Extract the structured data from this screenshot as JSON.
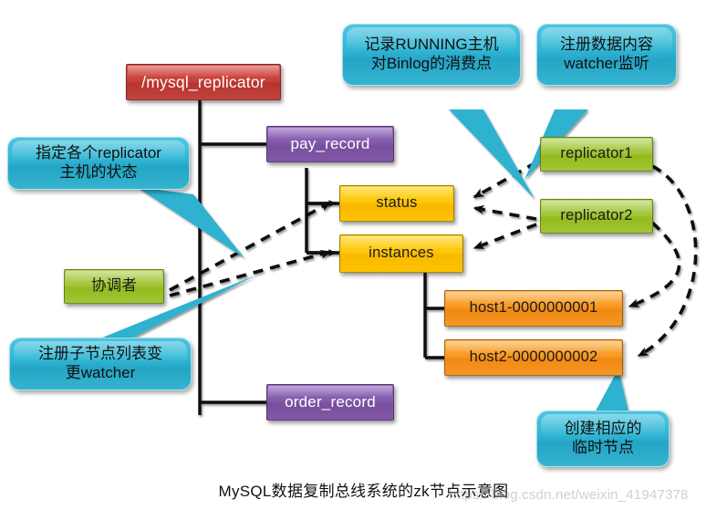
{
  "diagram": {
    "caption": "MySQL数据复制总线系统的zk节点示意图",
    "watermark": "https://blog.csdn.net/weixin_41947378",
    "background": "#ffffff"
  },
  "colors": {
    "root": "#c9403a",
    "namespace": "#845bab",
    "znode": "#fdc80d",
    "ephemeral": "#f79a25",
    "client": "#a4c73f",
    "callout": "#31b6d4",
    "connector": "#111111"
  },
  "tree": {
    "root": {
      "label": "/mysql_replicator",
      "type": "root-znode"
    },
    "namespaces": [
      {
        "label": "pay_record",
        "type": "namespace-znode"
      },
      {
        "label": "order_record",
        "type": "namespace-znode"
      }
    ],
    "children": [
      {
        "label": "status",
        "type": "znode"
      },
      {
        "label": "instances",
        "type": "znode"
      }
    ],
    "instances": [
      {
        "label": "host1-0000000001",
        "type": "ephemeral-sequential-znode"
      },
      {
        "label": "host2-0000000002",
        "type": "ephemeral-sequential-znode"
      }
    ]
  },
  "clients": [
    {
      "label": "replicator1",
      "type": "replicator-host"
    },
    {
      "label": "replicator2",
      "type": "replicator-host"
    },
    {
      "label": "协调者",
      "type": "coordinator"
    }
  ],
  "callouts": [
    {
      "id": "status-desc",
      "lines": [
        "指定各个replicator",
        "主机的状态"
      ]
    },
    {
      "id": "binlog-desc",
      "lines": [
        "记录RUNNING主机",
        "对Binlog的消费点"
      ]
    },
    {
      "id": "data-watcher",
      "lines": [
        "注册数据内容",
        "watcher监听"
      ]
    },
    {
      "id": "child-watcher",
      "lines": [
        "注册子节点列表变",
        "更watcher"
      ]
    },
    {
      "id": "ephemeral-create",
      "lines": [
        "创建相应的",
        "临时节点"
      ]
    }
  ]
}
